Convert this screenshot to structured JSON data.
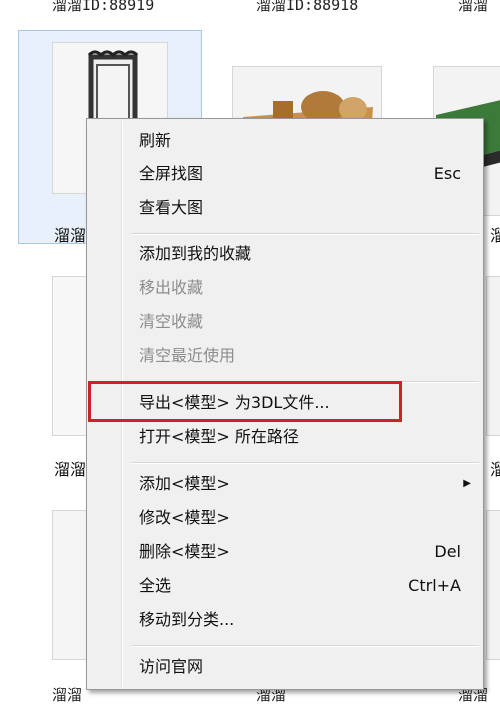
{
  "top_labels": [
    "溜溜ID:88919",
    "溜溜ID:88918",
    "溜溜"
  ],
  "tile_labels": [
    "溜溜",
    "溜溜",
    "溜溜",
    "溜溜"
  ],
  "bottom_labels": [
    "溜溜",
    "溜溜",
    "溜溜"
  ],
  "menu": {
    "refresh": "刷新",
    "fullscreen_find": "全屏找图",
    "fullscreen_find_shortcut": "Esc",
    "view_large": "查看大图",
    "add_favorites": "添加到我的收藏",
    "remove_favorites": "移出收藏",
    "clear_favorites": "清空收藏",
    "clear_recent": "清空最近使用",
    "export_3dl": "导出<模型> 为3DL文件...",
    "open_path": "打开<模型> 所在路径",
    "add_model": "添加<模型>",
    "modify_model": "修改<模型>",
    "delete_model": "删除<模型>",
    "delete_shortcut": "Del",
    "select_all": "全选",
    "select_all_shortcut": "Ctrl+A",
    "move_to_category": "移动到分类...",
    "visit_site": "访问官网"
  },
  "colors": {
    "highlight_border": "#d0202a",
    "selection_bg": "#e8f1fb",
    "menu_bg": "#f0f0f0",
    "disabled_text": "#8d8d8d"
  }
}
